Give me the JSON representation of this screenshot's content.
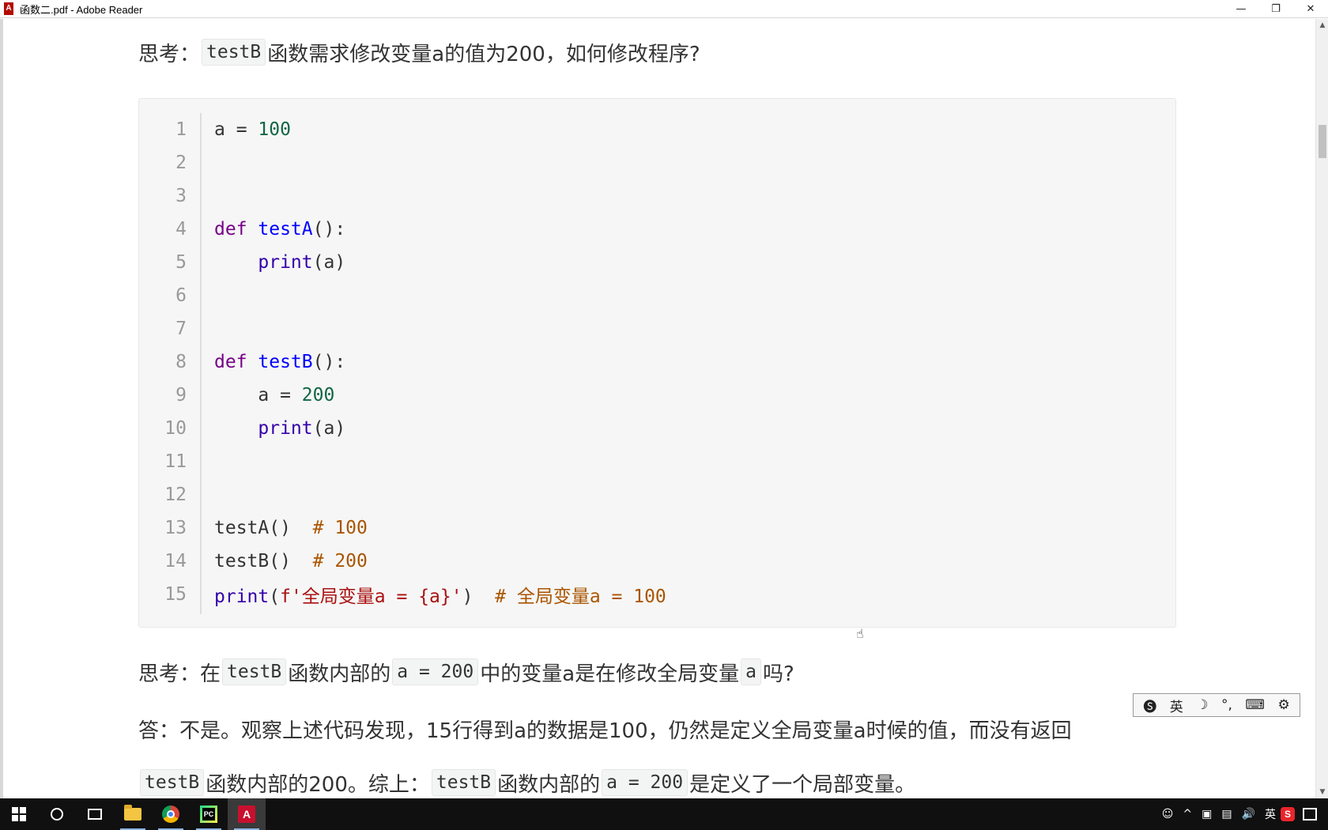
{
  "window": {
    "title": "函数二.pdf - Adobe Reader",
    "minimize": "—",
    "restore": "❐",
    "close": "✕"
  },
  "document": {
    "question1": {
      "prefix": "思考：",
      "code": "testB",
      "text": "函数需求修改变量a的值为200，如何修改程序?"
    },
    "code_lines": [
      {
        "n": "1"
      },
      {
        "n": "2"
      },
      {
        "n": "3"
      },
      {
        "n": "4"
      },
      {
        "n": "5"
      },
      {
        "n": "6"
      },
      {
        "n": "7"
      },
      {
        "n": "8"
      },
      {
        "n": "9"
      },
      {
        "n": "10"
      },
      {
        "n": "11"
      },
      {
        "n": "12"
      },
      {
        "n": "13"
      },
      {
        "n": "14"
      },
      {
        "n": "15"
      }
    ],
    "code_tokens": {
      "l1_a": "a = ",
      "l1_num": "100",
      "l4_kw": "def ",
      "l4_fn": "testA",
      "l4_rest": "():",
      "l5_indent": "    ",
      "l5_bi": "print",
      "l5_rest": "(a)",
      "l8_kw": "def ",
      "l8_fn": "testB",
      "l8_rest": "():",
      "l9_indent": "    ",
      "l9_a": "a = ",
      "l9_num": "200",
      "l10_indent": "    ",
      "l10_bi": "print",
      "l10_rest": "(a)",
      "l13_call": "testA()  ",
      "l13_cm": "# 100",
      "l14_call": "testB()  ",
      "l14_cm": "# 200",
      "l15_bi": "print",
      "l15_p1": "(",
      "l15_str": "f'全局变量a = {a}'",
      "l15_p2": ")  ",
      "l15_cm": "# 全局变量a = 100"
    },
    "question2": {
      "prefix": "思考：在",
      "code1": "testB",
      "mid1": "函数内部的",
      "code2": "a = 200",
      "mid2": "中的变量a是在修改全局变量",
      "code3": "a",
      "suffix": "吗?"
    },
    "answer": {
      "line1": "答：不是。观察上述代码发现，15行得到a的数据是100，仍然是定义全局变量a时候的值，而没有返回",
      "code1": "testB",
      "mid1": "函数内部的200。综上：",
      "code2": "testB",
      "mid2": "函数内部的",
      "code3": "a = 200",
      "suffix": "是定义了一个局部变量。"
    }
  },
  "ime_toolbar": {
    "logo": "🅢",
    "lang": "英",
    "moon": "☽",
    "punct": "°,",
    "keyboard": "⌨",
    "settings": "⚙"
  },
  "taskbar": {
    "tray_ime": "英",
    "tray_sogou": "S",
    "tray_chevron": "^",
    "tray_volume": "🔊"
  }
}
